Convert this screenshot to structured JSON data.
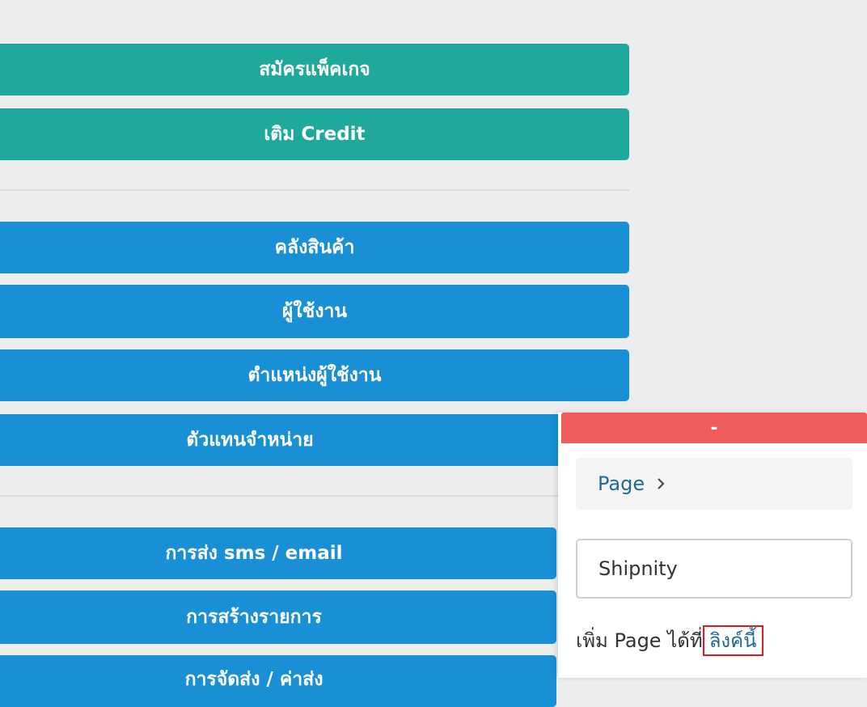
{
  "menu": {
    "subscribe_package": "สมัครแพ็คเกจ",
    "top_up_credit": "เติม Credit",
    "inventory": "คลังสินค้า",
    "users": "ผู้ใช้งาน",
    "user_roles": "ตำแหน่งผู้ใช้งาน",
    "dealers": "ตัวแทนจำหน่าย",
    "sms_email": "การส่ง sms / email",
    "create_order": "การสร้างรายการ",
    "shipping_partial": "การจัดส่ง / ค่าส่ง"
  },
  "panel": {
    "collapse_label": "-",
    "breadcrumb_label": "Page",
    "input_value": "Shipnity",
    "help_text": "เพิ่ม Page ได้ที่",
    "help_link": "ลิงค์นี้"
  },
  "colors": {
    "teal": "#1fa99a",
    "blue": "#1990d6",
    "red_header": "#f05b5d",
    "link": "#1e6a97",
    "highlight": "#e0181f"
  }
}
